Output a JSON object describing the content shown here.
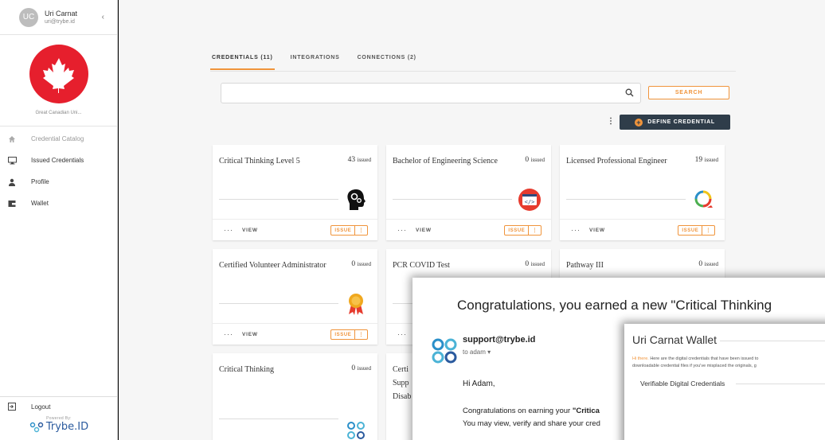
{
  "user": {
    "initials": "UC",
    "name": "Uri Carnat",
    "email": "uri@trybe.id"
  },
  "org": {
    "name": "Great Canadian Uni..."
  },
  "sidebar": {
    "items": [
      {
        "label": "Credential Catalog",
        "icon": "home-icon"
      },
      {
        "label": "Issued Credentials",
        "icon": "monitor-icon"
      },
      {
        "label": "Profile",
        "icon": "person-icon"
      },
      {
        "label": "Wallet",
        "icon": "wallet-icon"
      }
    ],
    "logout": "Logout",
    "powered_by": "Powered By:",
    "brand": "Trybe.ID"
  },
  "tabs": [
    {
      "label": "CREDENTIALS (11)",
      "active": true
    },
    {
      "label": "INTEGRATIONS",
      "active": false
    },
    {
      "label": "CONNECTIONS (2)",
      "active": false
    }
  ],
  "search": {
    "placeholder": "",
    "button": "SEARCH"
  },
  "define_button": "DEFINE CREDENTIAL",
  "card_actions": {
    "view": "VIEW",
    "issue": "ISSUE",
    "dots": "···",
    "more": "⋮"
  },
  "issued_suffix": "issued",
  "cards": [
    {
      "title": "Critical Thinking Level 5",
      "count": "43",
      "icon": "brain-gears-icon"
    },
    {
      "title": "Bachelor of Engineering Science",
      "count": "0",
      "icon": "code-icon"
    },
    {
      "title": "Licensed Professional Engineer",
      "count": "19",
      "icon": "cycle-arrows-icon"
    },
    {
      "title": "Certified Volunteer Administrator",
      "count": "0",
      "icon": "award-medal-icon"
    },
    {
      "title": "PCR COVID Test",
      "count": "0",
      "icon": ""
    },
    {
      "title": "Pathway III",
      "count": "0",
      "icon": ""
    },
    {
      "title": "Critical Thinking",
      "count": "0",
      "icon": "trybe-logo-icon"
    },
    {
      "title": "Certi Supp Disab",
      "count": "",
      "icon": ""
    }
  ],
  "email": {
    "subject": "Congratulations, you earned a new \"Critical Thinking",
    "from": "support@trybe.id",
    "to": "to adam ▾",
    "greeting": "Hi Adam,",
    "line1_prefix": "Congratulations on earning your ",
    "line1_bold": "\"Critica",
    "line2": "You may view, verify and share your cred"
  },
  "wallet": {
    "title": "Uri Carnat Wallet",
    "hi": "Hi there.",
    "text1": " Here are the digital credentials that have been issued to",
    "text2": "downloadable credential files if you've misplaced the originals, g",
    "subtitle": "Verifiable Digital Credentials"
  },
  "colors": {
    "accent": "#f0943b",
    "dark_button": "#2f3d4a",
    "maple": "#e61f2d"
  }
}
